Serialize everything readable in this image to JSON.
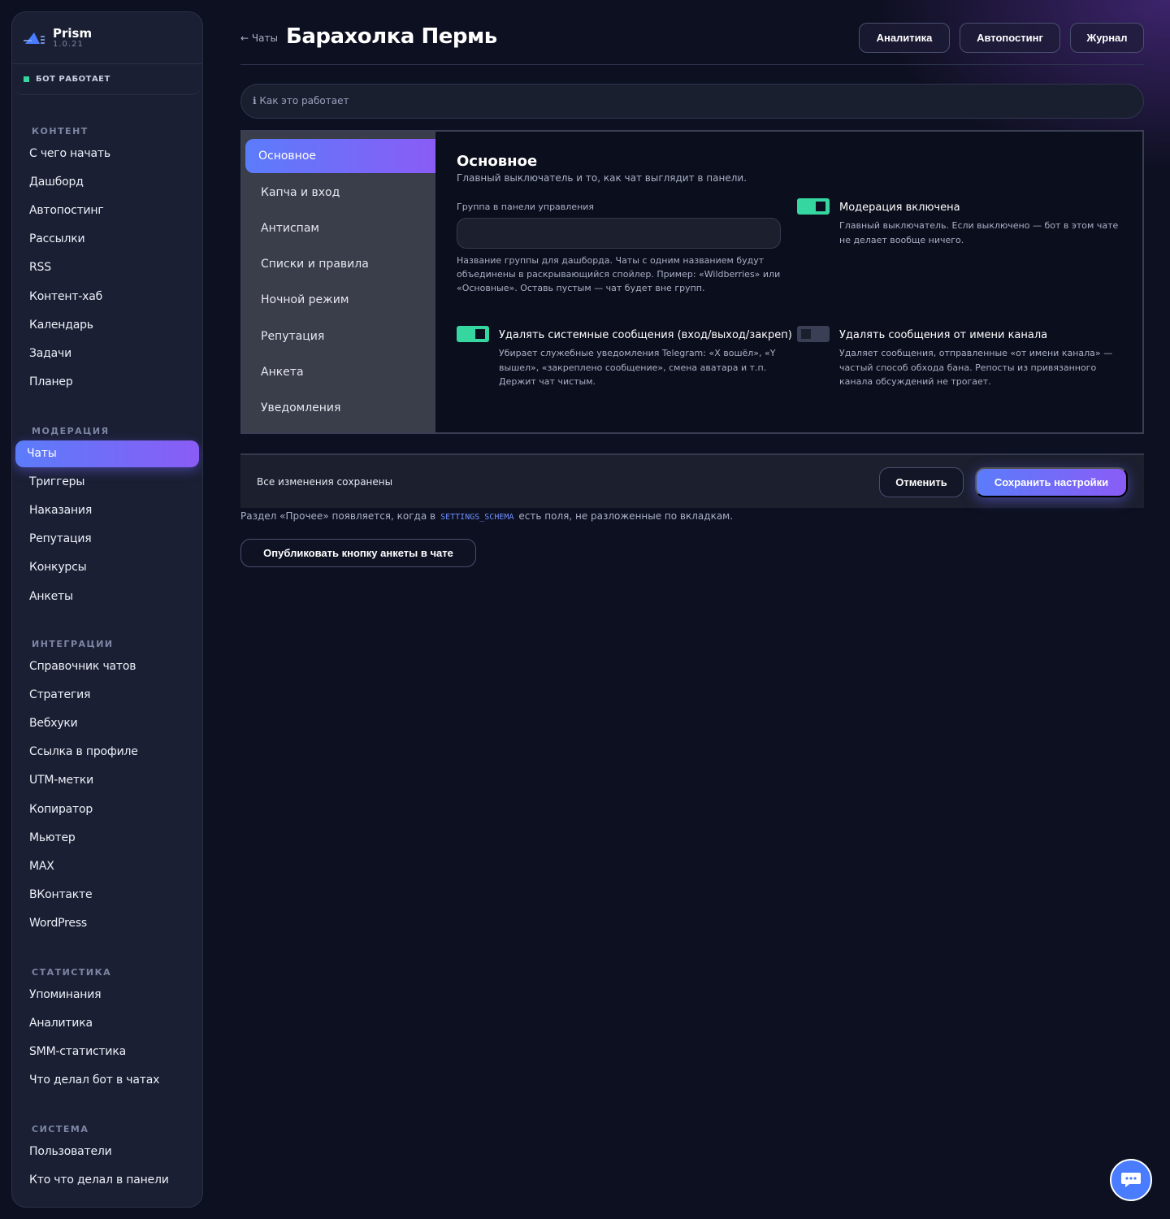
{
  "app": {
    "name": "Prism",
    "version": "1.0.21",
    "status": "БОТ РАБОТАЕТ"
  },
  "sidebar": {
    "sections": [
      {
        "title": "КОНТЕНТ",
        "items": [
          "С чего начать",
          "Дашборд",
          "Автопостинг",
          "Рассылки",
          "RSS",
          "Контент-хаб",
          "Календарь",
          "Задачи",
          "Планер"
        ]
      },
      {
        "title": "МОДЕРАЦИЯ",
        "items": [
          "Чаты",
          "Триггеры",
          "Наказания",
          "Репутация",
          "Конкурсы",
          "Анкеты"
        ]
      },
      {
        "title": "ИНТЕГРАЦИИ",
        "items": [
          "Справочник чатов",
          "Стратегия",
          "Вебхуки",
          "Ссылка в профиле",
          "UTM-метки",
          "Копиратор",
          "Мьютер",
          "MAX",
          "ВКонтакте",
          "WordPress"
        ]
      },
      {
        "title": "СТАТИСТИКА",
        "items": [
          "Упоминания",
          "Аналитика",
          "SMM-статистика",
          "Что делал бот в чатах"
        ]
      },
      {
        "title": "СИСТЕМА",
        "items": [
          "Пользователи",
          "Кто что делал в панели"
        ]
      }
    ],
    "active_item": "Чаты"
  },
  "header": {
    "back": "← Чаты",
    "title": "Барахолка Пермь",
    "buttons": [
      "Аналитика",
      "Автопостинг",
      "Журнал"
    ]
  },
  "info": {
    "text": "ℹ Как это работает"
  },
  "tabs": [
    "Основное",
    "Капча и вход",
    "Антиспам",
    "Списки и правила",
    "Ночной режим",
    "Репутация",
    "Анкета",
    "Уведомления"
  ],
  "active_tab": "Основное",
  "section": {
    "title": "Основное",
    "subtitle": "Главный выключатель и то, как чат выглядит в панели.",
    "group_label": "Группа в панели управления",
    "group_value": "",
    "group_help": "Название группы для дашборда. Чаты с одним названием будут объединены в раскрывающийся спойлер. Пример: «Wildberries» или «Основные». Оставь пустым — чат будет вне групп.",
    "options": [
      {
        "title": "Модерация включена",
        "desc": "Главный выключатель. Если выключено — бот в этом чате не делает вообще ничего.",
        "enabled": true
      },
      {
        "title": "Удалять системные сообщения (вход/выход/закреп)",
        "desc": "Убирает служебные уведомления Telegram: «X вошёл», «Y вышел», «закреплено сообщение», смена аватара и т.п. Держит чат чистым.",
        "enabled": true
      },
      {
        "title": "Удалять сообщения от имени канала",
        "desc": "Удаляет сообщения, отправленные «от имени канала» — частый способ обхода бана. Репосты из привязанного канала обсуждений не трогает.",
        "enabled": false
      }
    ]
  },
  "save_bar": {
    "status": "Все изменения сохранены",
    "cancel": "Отменить",
    "save": "Сохранить настройки"
  },
  "note": {
    "before": "Раздел «Прочее» появляется, когда в",
    "code": "SETTINGS_SCHEMA",
    "after": "есть поля, не разложенные по вкладкам."
  },
  "publish_button": "Опубликовать кнопку анкеты в чате",
  "colors": {
    "accent_start": "#5b7cfa",
    "accent_end": "#8a5cf6",
    "toggle_on": "#35d6a0",
    "bg": "#0d1020"
  },
  "icons": {
    "logo": "prism-logo-icon",
    "chat": "chat-bubble-icon"
  }
}
